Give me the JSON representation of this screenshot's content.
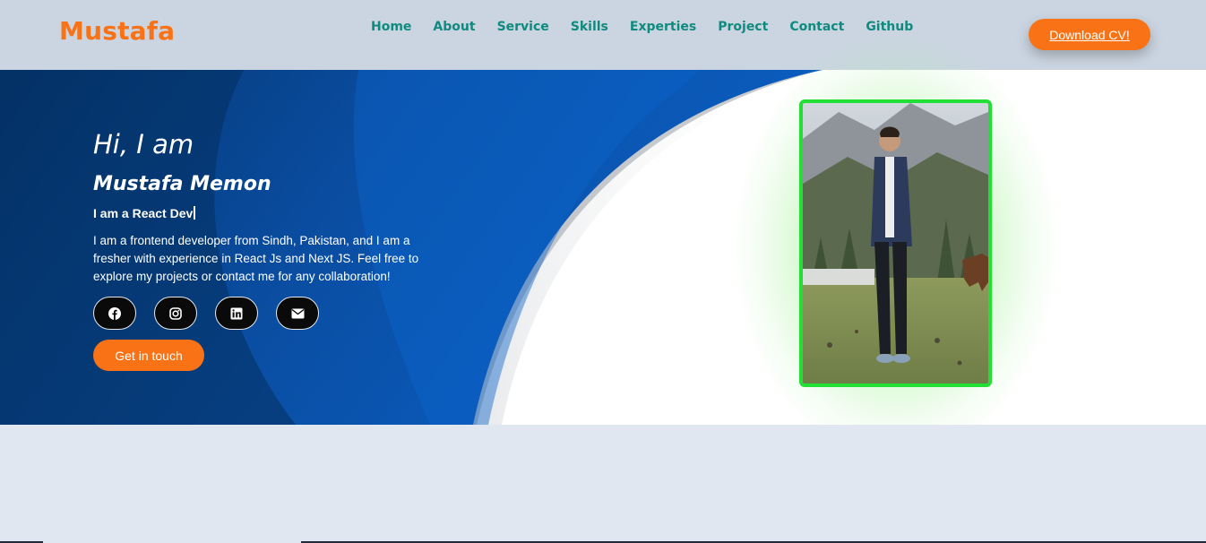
{
  "brand": {
    "logo": "Mustafa"
  },
  "nav": {
    "items": [
      "Home",
      "About",
      "Service",
      "Skills",
      "Experties",
      "Project",
      "Contact",
      "Github"
    ],
    "download_label": "Download CV!"
  },
  "hero": {
    "greeting": "Hi, I am",
    "name": "Mustafa Memon",
    "role": "I am a React Dev",
    "description": "I am a frontend developer from Sindh, Pakistan, and I am a fresher with experience in React Js and Next JS. Feel free to explore my projects or contact me for any collaboration!",
    "social": [
      {
        "icon": "facebook-icon"
      },
      {
        "icon": "instagram-icon"
      },
      {
        "icon": "linkedin-icon"
      },
      {
        "icon": "envelope-icon"
      }
    ],
    "cta_label": "Get in touch"
  },
  "colors": {
    "accent": "#f97316",
    "nav_link": "#0f8a7e",
    "navbar_bg": "#cbd5e1",
    "hero_blue": "#0a4ea3",
    "photo_border": "#22e033"
  }
}
